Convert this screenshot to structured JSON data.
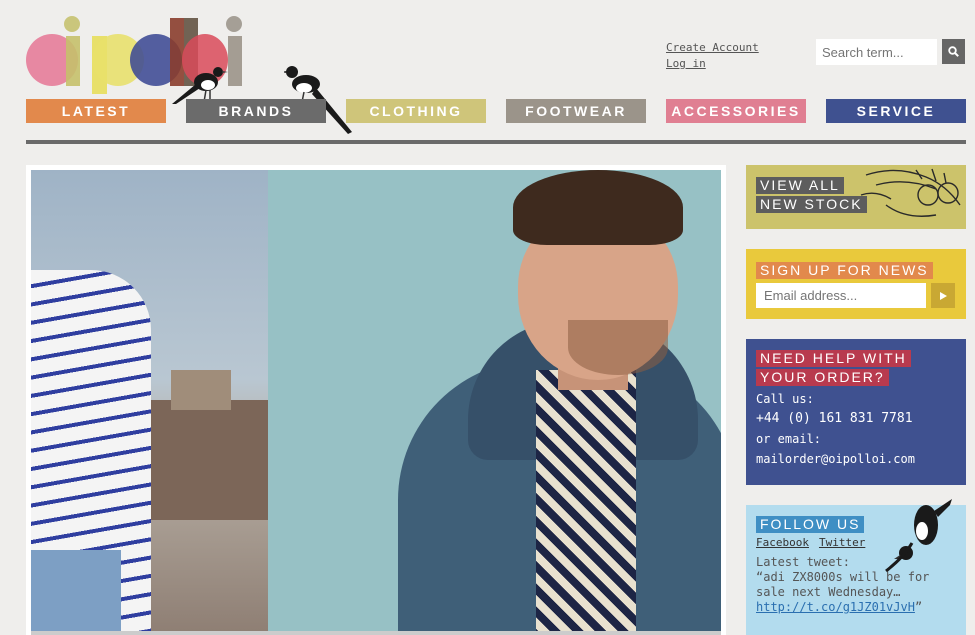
{
  "logo": {
    "alt": "oi polloi"
  },
  "account": {
    "create": "Create Account",
    "login": "Log in"
  },
  "search": {
    "placeholder": "Search term..."
  },
  "nav": [
    {
      "label": "LATEST",
      "color": "#e2894c"
    },
    {
      "label": "BRANDS",
      "color": "#6b6b6b"
    },
    {
      "label": "CLOTHING",
      "color": "#cfc57a"
    },
    {
      "label": "FOOTWEAR",
      "color": "#9b948a"
    },
    {
      "label": "ACCESSORIES",
      "color": "#e07f92"
    },
    {
      "label": "SERVICE",
      "color": "#3f5190"
    }
  ],
  "sidebar": {
    "new_stock": {
      "line1": "VIEW ALL",
      "line2": "NEW STOCK"
    },
    "newsletter": {
      "heading": "SIGN UP FOR NEWS",
      "placeholder": "Email address..."
    },
    "help": {
      "heading1": "NEED HELP WITH",
      "heading2": "YOUR ORDER?",
      "call_label": "Call us:",
      "phone": "+44 (0) 161 831 7781",
      "email_label": "or email:",
      "email": "mailorder@oipolloi.com"
    },
    "follow": {
      "heading": "FOLLOW US",
      "facebook": "Facebook",
      "twitter": "Twitter",
      "tweet_label": "Latest tweet:",
      "tweet_text": "“adi ZX8000s will be for sale next Wednesday… ",
      "tweet_link": "http://t.co/g1JZ01vJvH",
      "tweet_end": "”"
    }
  },
  "colors": {
    "background": "#efeeec",
    "new_stock_bg": "#ccc36b",
    "newsletter_bg": "#e9c93c",
    "help_bg": "#3f5190",
    "follow_bg": "#b3dcee"
  }
}
